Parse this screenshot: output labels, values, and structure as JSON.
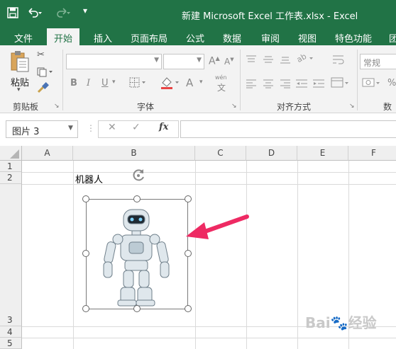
{
  "window": {
    "title": "新建 Microsoft Excel 工作表.xlsx - Excel"
  },
  "quick_access": {
    "save_icon": "save-icon",
    "undo_icon": "undo-icon",
    "redo_icon": "redo-icon",
    "customize_icon": "customize-icon"
  },
  "tabs": [
    {
      "label": "文件"
    },
    {
      "label": "开始"
    },
    {
      "label": "插入"
    },
    {
      "label": "页面布局"
    },
    {
      "label": "公式"
    },
    {
      "label": "数据"
    },
    {
      "label": "审阅"
    },
    {
      "label": "视图"
    },
    {
      "label": "特色功能"
    },
    {
      "label": "团"
    }
  ],
  "ribbon": {
    "clipboard": {
      "paste_label": "粘贴",
      "group_label": "剪贴板"
    },
    "font": {
      "group_label": "字体",
      "bold": "B",
      "italic": "I",
      "underline": "U",
      "font_color": "A",
      "wen": "wén"
    },
    "alignment": {
      "group_label": "对齐方式"
    },
    "number": {
      "format_value": "常规",
      "group_label": "数"
    }
  },
  "formula_bar": {
    "name_box": "图片 3",
    "cancel": "✕",
    "enter": "✓",
    "fx": "fx",
    "value": ""
  },
  "columns": [
    {
      "label": "A"
    },
    {
      "label": "B"
    },
    {
      "label": "C"
    },
    {
      "label": "D"
    },
    {
      "label": "E"
    },
    {
      "label": "F"
    }
  ],
  "rows": [
    {
      "label": "1"
    },
    {
      "label": "2"
    },
    {
      "label": "3"
    },
    {
      "label": "4"
    },
    {
      "label": "5"
    }
  ],
  "cells": {
    "B2": "机器人"
  },
  "colors": {
    "excel_green": "#217346",
    "arrow_pink": "#ee2a63"
  }
}
